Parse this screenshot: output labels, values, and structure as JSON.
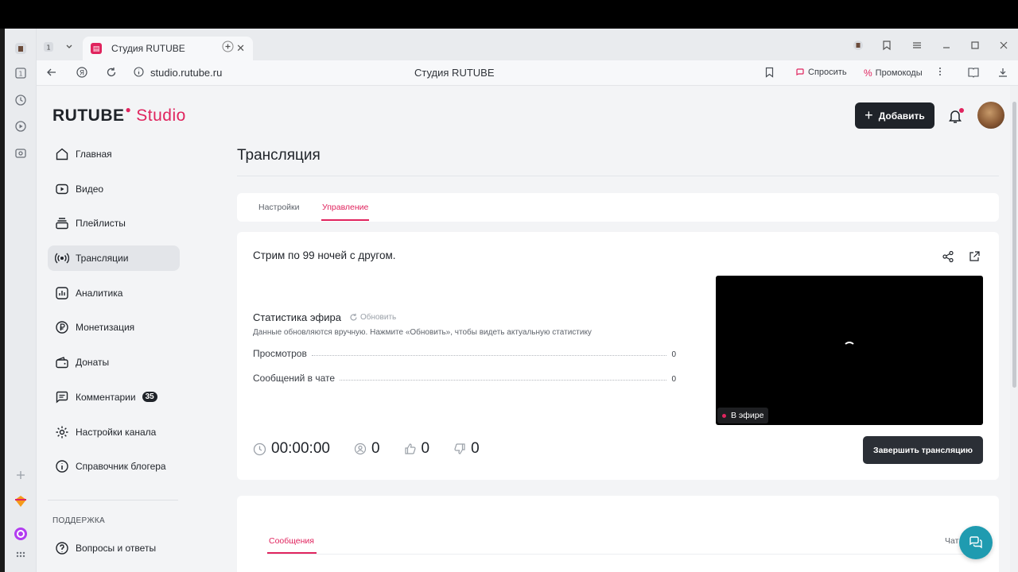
{
  "browser": {
    "tab_title": "Студия RUTUBE",
    "tab_counter": "1",
    "url": "studio.rutube.ru",
    "page_title_center": "Студия RUTUBE",
    "ask_label": "Спросить",
    "promo_label": "Промокоды"
  },
  "header": {
    "logo_main": "RUTUBE",
    "logo_studio": "Studio",
    "add_label": "Добавить"
  },
  "sidebar": {
    "items": [
      {
        "label": "Главная",
        "icon": "home-icon"
      },
      {
        "label": "Видео",
        "icon": "video-icon"
      },
      {
        "label": "Плейлисты",
        "icon": "playlist-icon"
      },
      {
        "label": "Трансляции",
        "icon": "broadcast-icon"
      },
      {
        "label": "Аналитика",
        "icon": "analytics-icon"
      },
      {
        "label": "Монетизация",
        "icon": "ruble-icon"
      },
      {
        "label": "Донаты",
        "icon": "wallet-icon"
      },
      {
        "label": "Комментарии",
        "icon": "comment-icon",
        "badge": "35"
      },
      {
        "label": "Настройки канала",
        "icon": "gear-icon"
      },
      {
        "label": "Справочник блогера",
        "icon": "info-icon"
      }
    ],
    "support_heading": "ПОДДЕРЖКА",
    "faq_label": "Вопросы и ответы"
  },
  "main": {
    "title": "Трансляция",
    "tabs": [
      {
        "label": "Настройки",
        "active": false
      },
      {
        "label": "Управление",
        "active": true
      }
    ],
    "stream_title": "Стрим по 99 ночей с другом.",
    "stats": {
      "title": "Статистика эфира",
      "refresh_label": "Обновить",
      "hint": "Данные обновляются вручную. Нажмите «Обновить», чтобы видеть актуальную статистику",
      "rows": [
        {
          "label": "Просмотров",
          "value": "0"
        },
        {
          "label": "Сообщений в чате",
          "value": "0"
        }
      ]
    },
    "counters": {
      "duration": "00:00:00",
      "viewers": "0",
      "likes": "0",
      "dislikes": "0"
    },
    "live_label": "В эфире",
    "end_button": "Завершить трансляцию",
    "bottom_tabs": {
      "messages": "Сообщения",
      "chat": "Чат"
    }
  },
  "colors": {
    "accent": "#e0245e",
    "dark": "#1f2329",
    "fab": "#1f9bb0"
  }
}
